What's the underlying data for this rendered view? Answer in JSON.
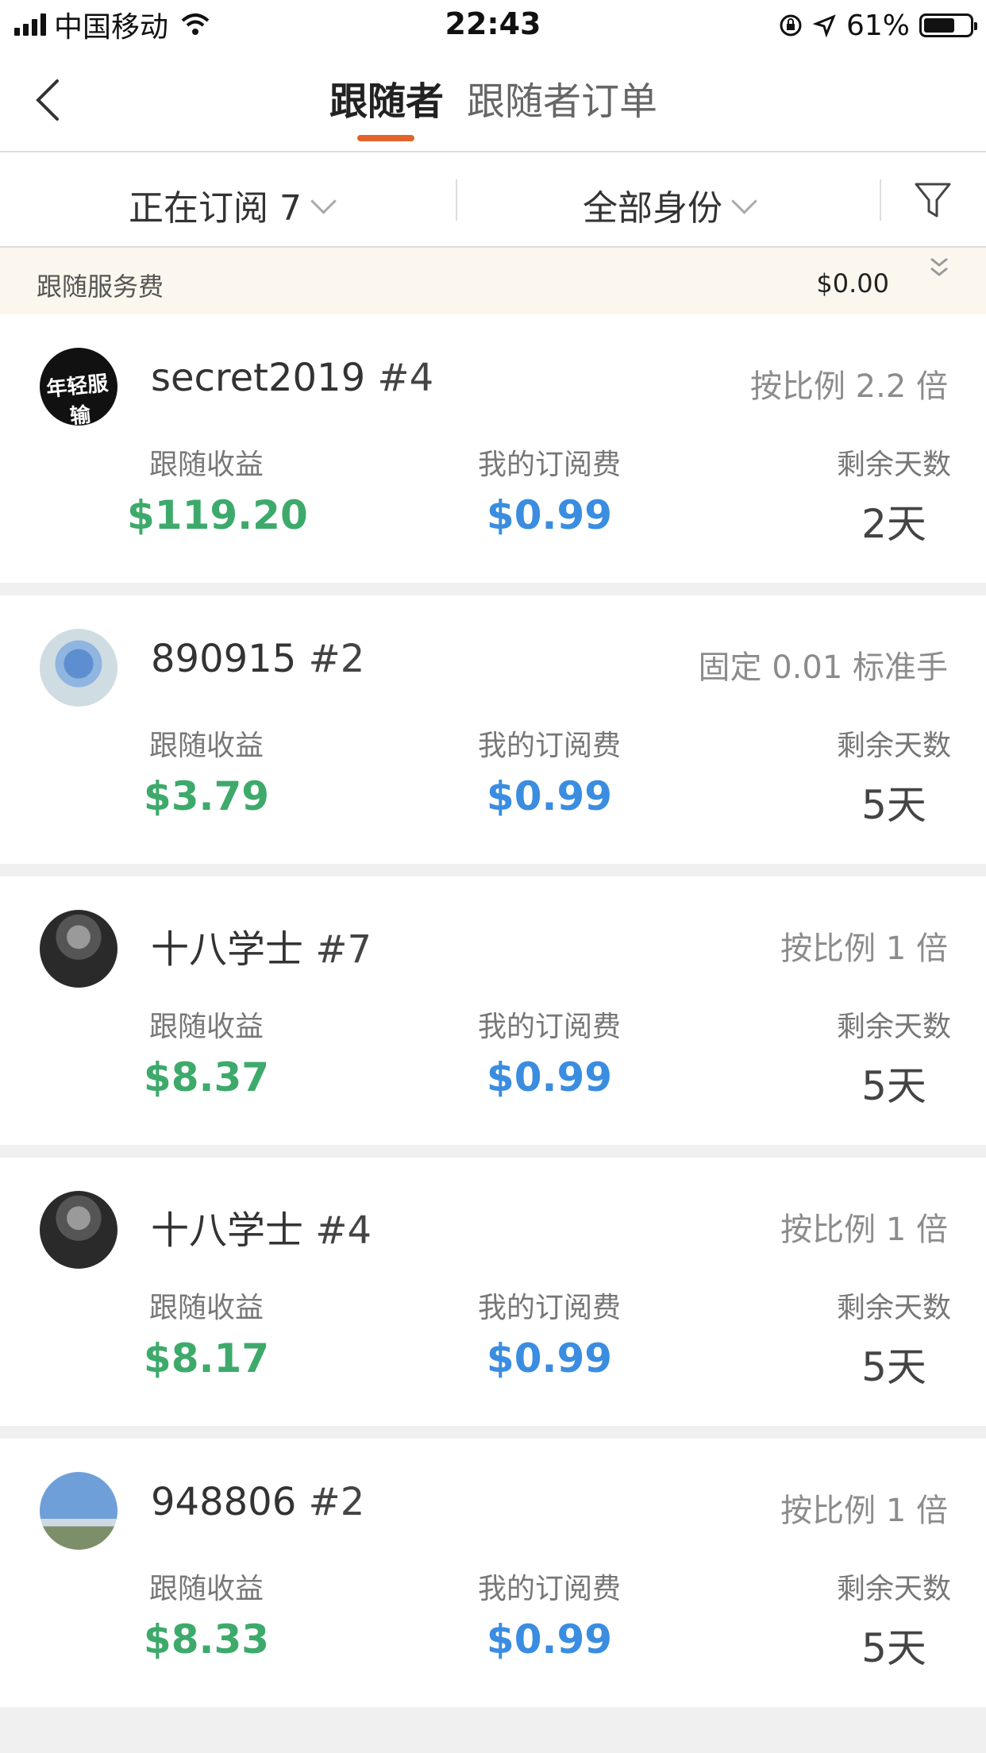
{
  "status": {
    "carrier": "中国移动",
    "time": "22:43",
    "battery": "61%"
  },
  "nav": {
    "tab_active": "跟随者",
    "tab_inactive": "跟随者订单"
  },
  "filter": {
    "subscribing": "正在订阅 7",
    "identity": "全部身份"
  },
  "fee": {
    "label": "跟随服务费",
    "value": "$0.00"
  },
  "labels": {
    "profit": "跟随收益",
    "fee": "我的订阅费",
    "days": "剩余天数"
  },
  "followers": [
    {
      "name": "secret2019",
      "id": "#4",
      "mode": "按比例 2.2 倍",
      "profit": "$119.20",
      "fee": "$0.99",
      "days": "2天",
      "avatar": "avatar-text-logo"
    },
    {
      "name": "890915",
      "id": "#2",
      "mode": "固定 0.01 标准手",
      "profit": "$3.79",
      "fee": "$0.99",
      "days": "5天",
      "avatar": "avatar-flowers"
    },
    {
      "name": "十八学士",
      "id": "#7",
      "mode": "按比例 1 倍",
      "profit": "$8.37",
      "fee": "$0.99",
      "days": "5天",
      "avatar": "avatar-cat"
    },
    {
      "name": "十八学士",
      "id": "#4",
      "mode": "按比例 1 倍",
      "profit": "$8.17",
      "fee": "$0.99",
      "days": "5天",
      "avatar": "avatar-cat"
    },
    {
      "name": "948806",
      "id": "#2",
      "mode": "按比例 1 倍",
      "profit": "$8.33",
      "fee": "$0.99",
      "days": "5天",
      "avatar": "avatar-statue"
    }
  ],
  "avatar_text": "年轻服输",
  "colors": {
    "profit": "#3daa6b",
    "fee": "#3a8de0",
    "accent": "#e2642b"
  }
}
